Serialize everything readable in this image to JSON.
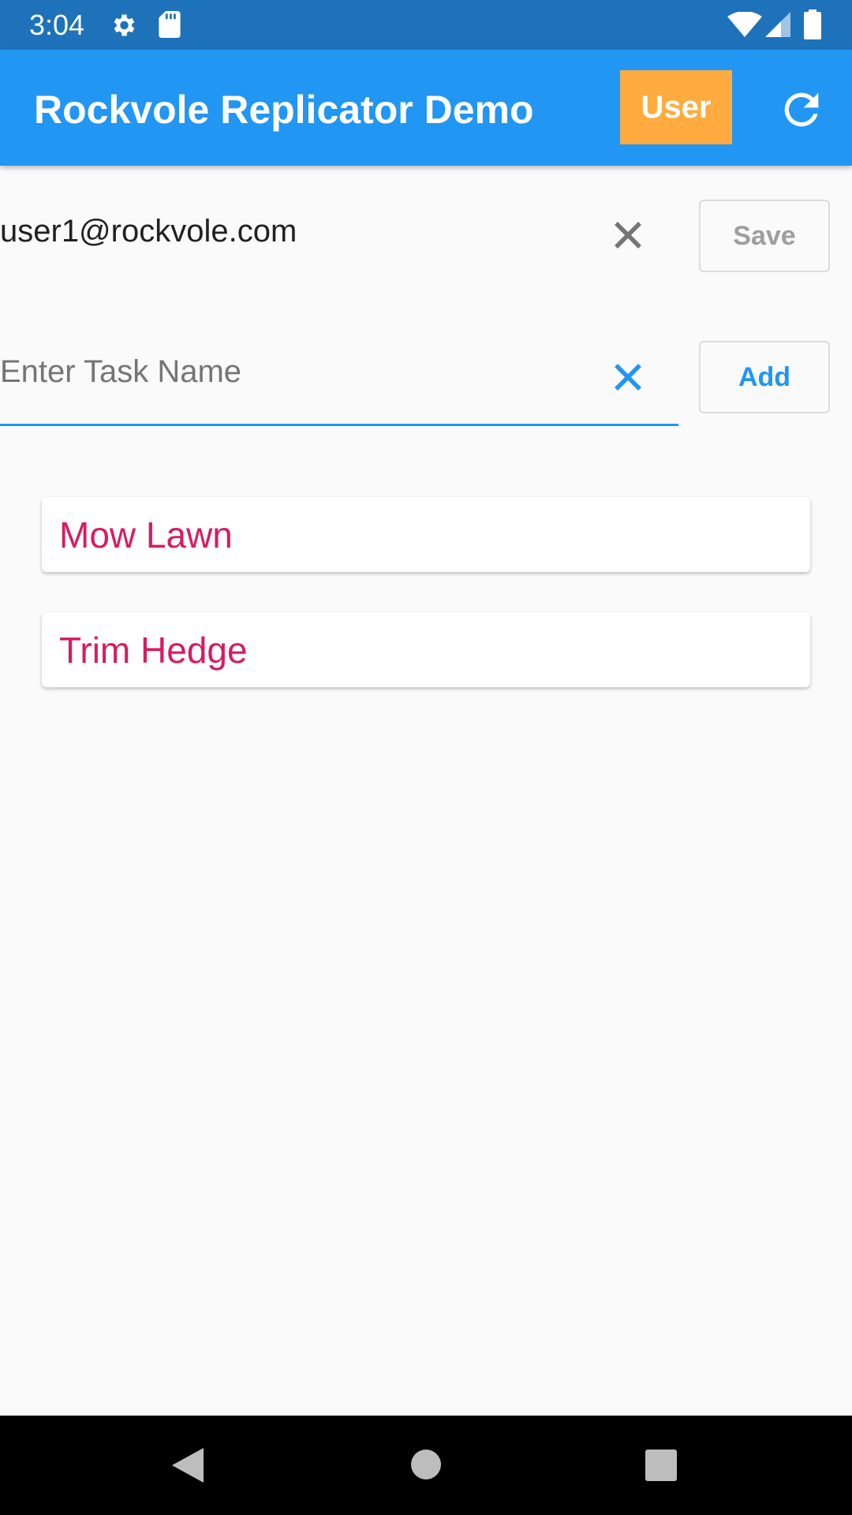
{
  "status_bar": {
    "time": "3:04",
    "icons": [
      "gear-icon",
      "sd-card-icon",
      "wifi-icon",
      "signal-icon",
      "battery-icon"
    ]
  },
  "app_bar": {
    "title": "Rockvole Replicator Demo",
    "user_button_label": "User",
    "refresh_icon": "refresh-icon",
    "colors": {
      "background": "#2196f3",
      "user_button": "#ffab40"
    }
  },
  "user_field": {
    "value": "user1@rockvole.com",
    "clear_icon": "close-icon",
    "save_label": "Save"
  },
  "task_field": {
    "value": "",
    "placeholder": "Enter Task Name",
    "clear_icon": "close-icon",
    "add_label": "Add"
  },
  "tasks": [
    {
      "label": "Mow Lawn"
    },
    {
      "label": "Trim Hedge"
    }
  ],
  "colors": {
    "task_text": "#d81b60",
    "accent": "#2196f3"
  },
  "nav_bar": {
    "icons": [
      "back-icon",
      "home-icon",
      "recents-icon"
    ]
  }
}
